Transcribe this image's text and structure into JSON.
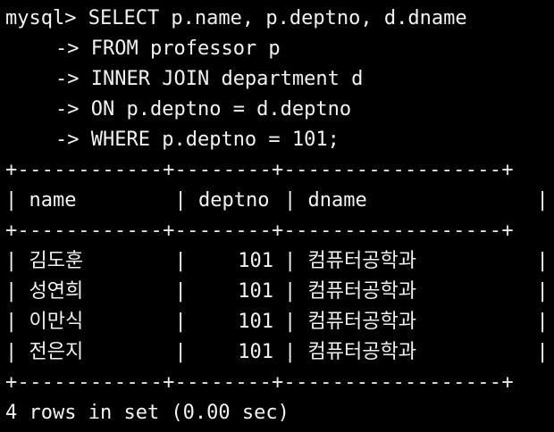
{
  "terminal": {
    "prompt": "mysql> ",
    "continuation": "-> ",
    "query_lines": [
      "SELECT p.name, p.deptno, d.dname",
      "FROM professor p",
      "INNER JOIN department d",
      "ON p.deptno = d.deptno",
      "WHERE p.deptno = 101;"
    ],
    "table": {
      "border": "+------------+--------+------------------+",
      "header": "| name       | deptno | dname            |",
      "columns": [
        "name",
        "deptno",
        "dname"
      ],
      "rows": [
        {
          "name": "김도훈",
          "deptno": "101",
          "dname": "컴퓨터공학과"
        },
        {
          "name": "성연희",
          "deptno": "101",
          "dname": "컴퓨터공학과"
        },
        {
          "name": "이만식",
          "deptno": "101",
          "dname": "컴퓨터공학과"
        },
        {
          "name": "전은지",
          "deptno": "101",
          "dname": "컴퓨터공학과"
        }
      ]
    },
    "result_summary": "4 rows in set (0.00 sec)",
    "colors": {
      "background": "#000000",
      "text": "#f2f2f2"
    }
  }
}
